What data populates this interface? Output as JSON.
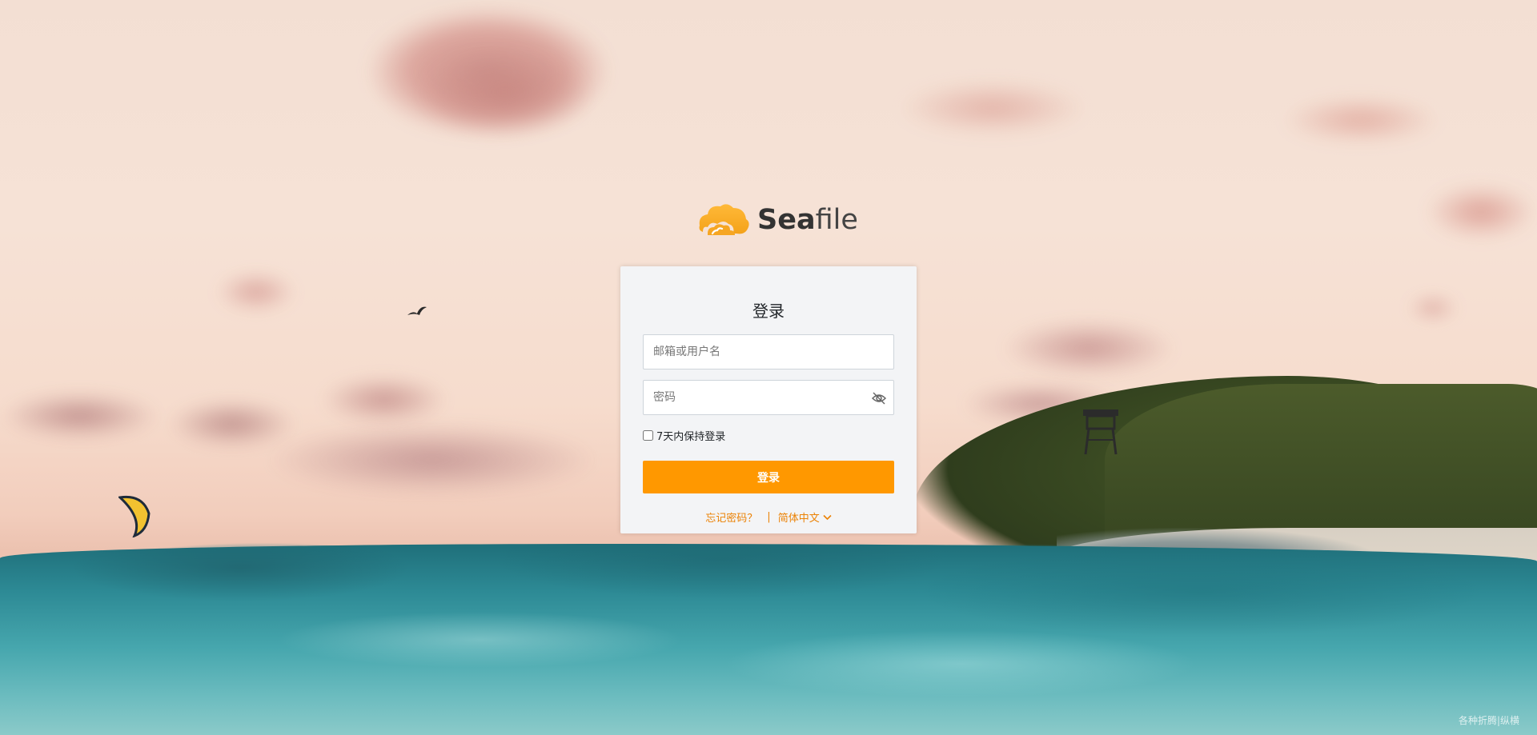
{
  "logo": {
    "text_bold": "Sea",
    "text_light": "file",
    "icon": "seafile-cloud-logo"
  },
  "login": {
    "title": "登录",
    "username_placeholder": "邮箱或用户名",
    "username_value": "",
    "password_placeholder": "密码",
    "password_value": "",
    "remember_label": "7天内保持登录",
    "remember_checked": false,
    "submit_label": "登录",
    "forgot_password_label": "忘记密码？",
    "separator": "|",
    "language_label": "简体中文",
    "password_toggle_icon": "eye-slash-icon",
    "language_icon": "chevron-down-icon"
  },
  "background": {
    "watermark_text": "各种折腾|纵横"
  },
  "colors": {
    "accent": "#ff9800",
    "link": "#eb8205",
    "card_bg": "#f3f4f6"
  }
}
